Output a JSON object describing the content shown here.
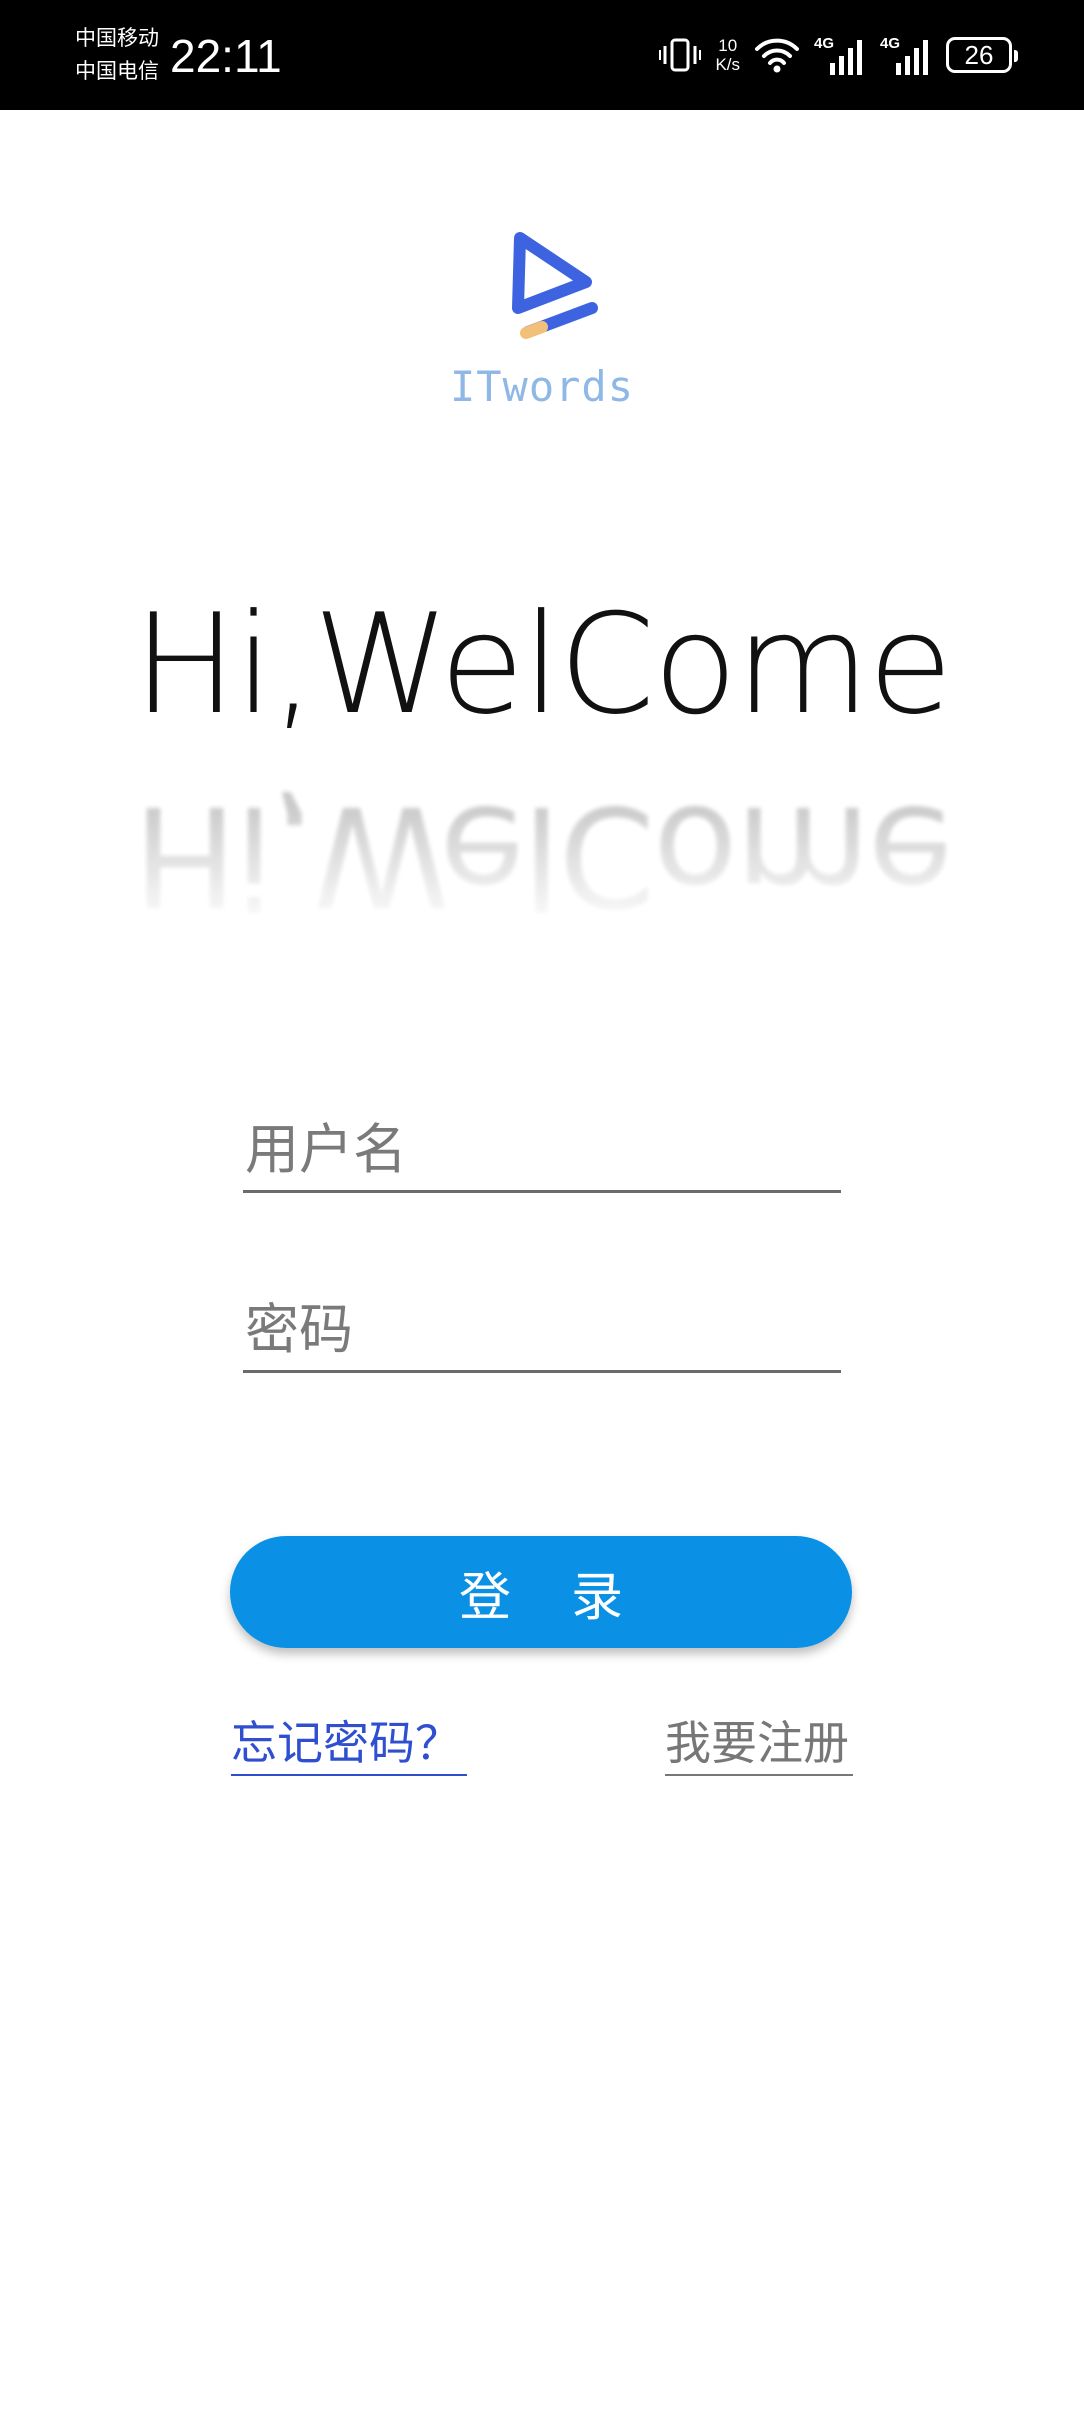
{
  "status_bar": {
    "carrier_1": "中国移动",
    "carrier_2": "中国电信",
    "time": "22:11",
    "net_speed_value": "10",
    "net_speed_unit": "K/s",
    "signal_1_label": "4G",
    "signal_2_label": "4G",
    "battery_level": "26"
  },
  "logo": {
    "brand_name": "ITwords",
    "colors": {
      "primary": "#3d63e0",
      "accent": "#f2c079",
      "brand_text": "#8fb8e6"
    }
  },
  "welcome": {
    "text": "Hi,WelCome"
  },
  "form": {
    "username_placeholder": "用户名",
    "password_placeholder": "密码",
    "login_label": "登录",
    "button_color": "#0a91e6"
  },
  "links": {
    "forgot_password": "忘记密码？",
    "register": "我要注册"
  }
}
